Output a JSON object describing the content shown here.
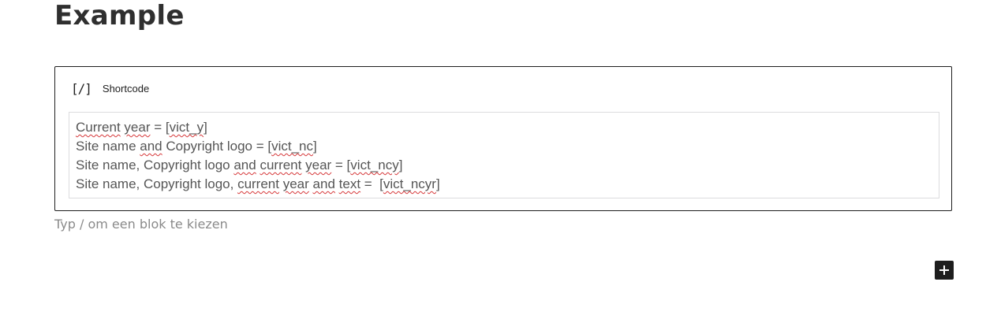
{
  "page": {
    "title": "Example"
  },
  "block": {
    "icon": "shortcode-icon",
    "icon_text": "[/]",
    "title": "Shortcode",
    "lines": [
      [
        {
          "text": "Current",
          "sp": true
        },
        {
          "text": " ",
          "sp": false
        },
        {
          "text": "year",
          "sp": true
        },
        {
          "text": " = [",
          "sp": false
        },
        {
          "text": "vict_y",
          "sp": true
        },
        {
          "text": "]",
          "sp": false
        }
      ],
      [
        {
          "text": "Site name ",
          "sp": false
        },
        {
          "text": "and",
          "sp": true
        },
        {
          "text": " Copyright logo = [",
          "sp": false
        },
        {
          "text": "vict_nc",
          "sp": true
        },
        {
          "text": "]",
          "sp": false
        }
      ],
      [
        {
          "text": "Site name, Copyright logo ",
          "sp": false
        },
        {
          "text": "and",
          "sp": true
        },
        {
          "text": " ",
          "sp": false
        },
        {
          "text": "current",
          "sp": true
        },
        {
          "text": " ",
          "sp": false
        },
        {
          "text": "year",
          "sp": true
        },
        {
          "text": " = [",
          "sp": false
        },
        {
          "text": "vict_ncy",
          "sp": true
        },
        {
          "text": "]",
          "sp": false
        }
      ],
      [
        {
          "text": "Site name, Copyright logo, ",
          "sp": false
        },
        {
          "text": "current",
          "sp": true
        },
        {
          "text": " ",
          "sp": false
        },
        {
          "text": "year",
          "sp": true
        },
        {
          "text": " ",
          "sp": false
        },
        {
          "text": "and",
          "sp": true
        },
        {
          "text": " ",
          "sp": false
        },
        {
          "text": "text",
          "sp": true
        },
        {
          "text": " =  [",
          "sp": false
        },
        {
          "text": "vict_ncyr",
          "sp": true
        },
        {
          "text": "]",
          "sp": false
        }
      ]
    ]
  },
  "appender": {
    "placeholder": "Typ / om een blok te kiezen"
  },
  "add_button": {
    "icon": "plus-icon"
  },
  "colors": {
    "spellcheck_underline": "#d63638",
    "button_bg": "#1e1e1e",
    "placeholder_text": "#8a8a8a"
  }
}
